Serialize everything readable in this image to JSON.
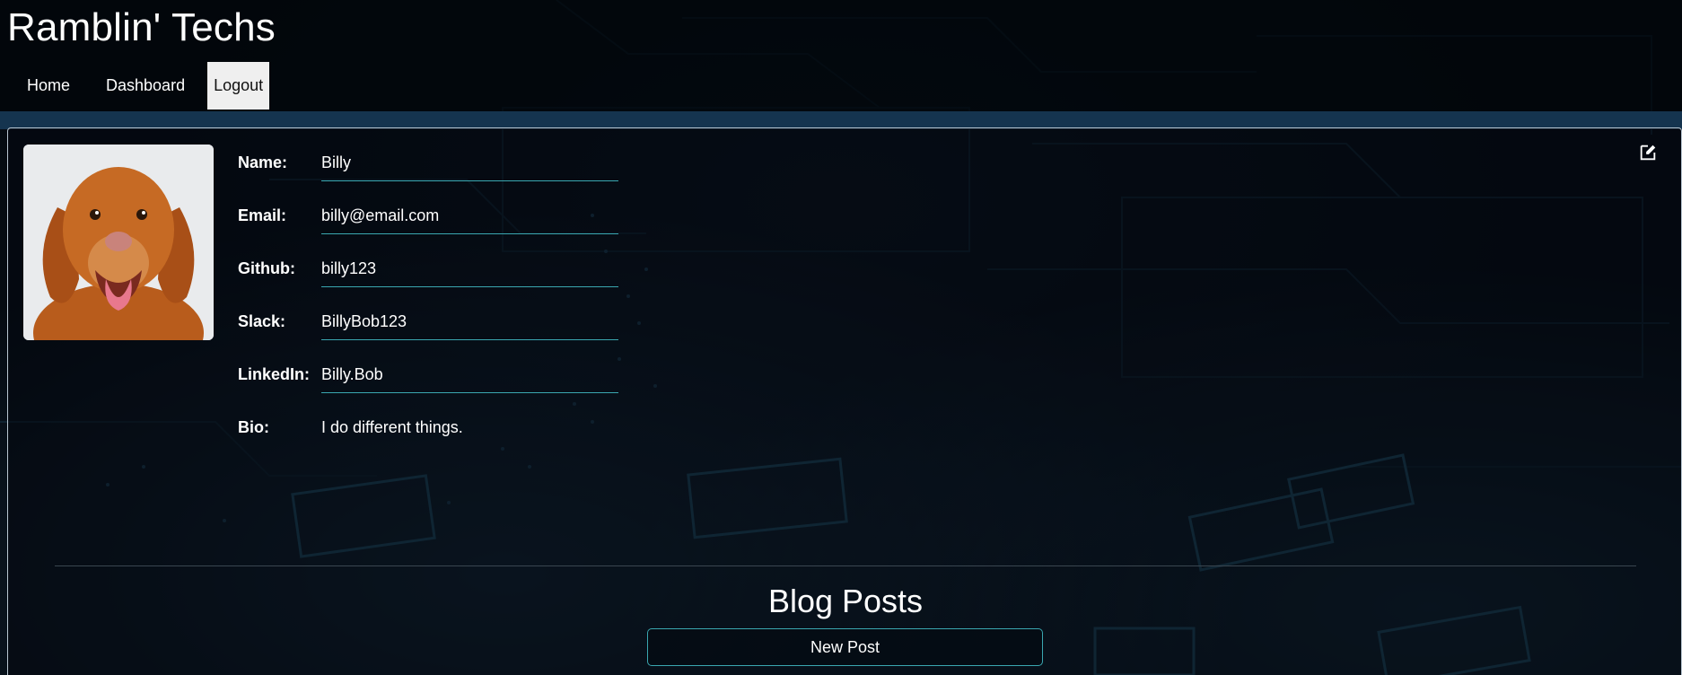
{
  "site": {
    "title": "Ramblin' Techs"
  },
  "nav": {
    "items": [
      {
        "label": "Home"
      },
      {
        "label": "Dashboard"
      },
      {
        "label": "Logout",
        "active": true
      }
    ]
  },
  "profile": {
    "avatar_alt": "dog-photo",
    "fields": [
      {
        "label": "Name:",
        "value": "Billy"
      },
      {
        "label": "Email:",
        "value": "billy@email.com"
      },
      {
        "label": "Github:",
        "value": "billy123"
      },
      {
        "label": "Slack:",
        "value": "BillyBob123"
      },
      {
        "label": "LinkedIn:",
        "value": "Billy.Bob"
      },
      {
        "label": "Bio:",
        "value": "I do different things."
      }
    ],
    "edit_icon": "edit-icon"
  },
  "blog": {
    "title": "Blog Posts",
    "new_post_label": "New Post"
  },
  "colors": {
    "accent": "#3aa7b0",
    "background": "#050b12",
    "band": "#15344f"
  }
}
